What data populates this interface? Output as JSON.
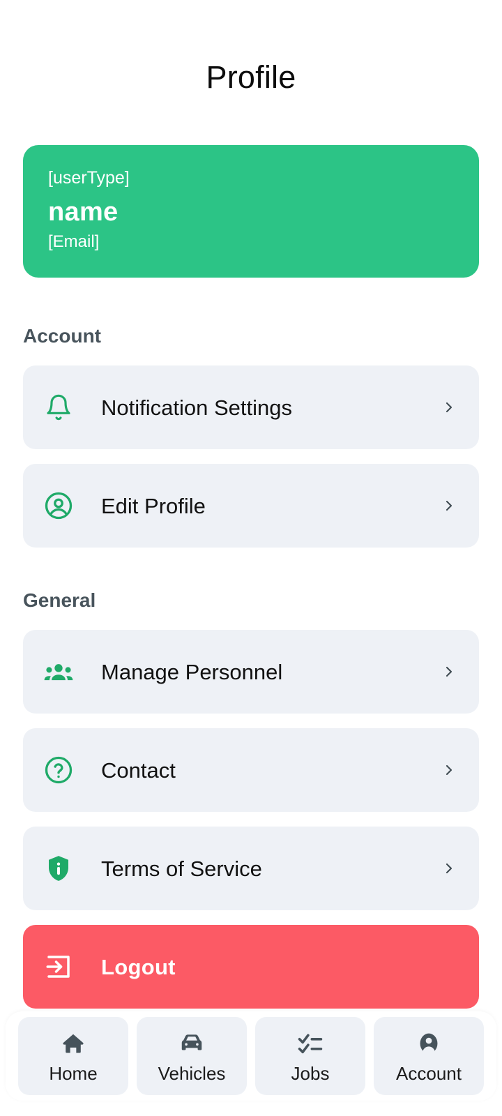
{
  "header": {
    "title": "Profile"
  },
  "profile_card": {
    "user_type": "[userType]",
    "name": "name",
    "email": "[Email]",
    "background_color": "#2cc486"
  },
  "sections": [
    {
      "title": "Account",
      "items": [
        {
          "label": "Notification Settings",
          "icon": "bell-icon"
        },
        {
          "label": "Edit Profile",
          "icon": "user-circle-icon"
        }
      ]
    },
    {
      "title": "General",
      "items": [
        {
          "label": "Manage Personnel",
          "icon": "people-group-icon"
        },
        {
          "label": "Contact",
          "icon": "question-circle-icon"
        },
        {
          "label": "Terms of Service",
          "icon": "shield-info-icon"
        }
      ]
    }
  ],
  "logout": {
    "label": "Logout",
    "icon": "logout-icon",
    "background_color": "#fc5a65"
  },
  "bottom_nav": {
    "items": [
      {
        "label": "Home",
        "icon": "home-icon"
      },
      {
        "label": "Vehicles",
        "icon": "car-icon"
      },
      {
        "label": "Jobs",
        "icon": "checklist-icon"
      },
      {
        "label": "Account",
        "icon": "person-icon"
      }
    ]
  },
  "colors": {
    "accent_green": "#1faa68",
    "row_background": "#eef1f6",
    "chevron": "#3f4b52",
    "section_header": "#48545c",
    "nav_icon": "#46535b"
  }
}
